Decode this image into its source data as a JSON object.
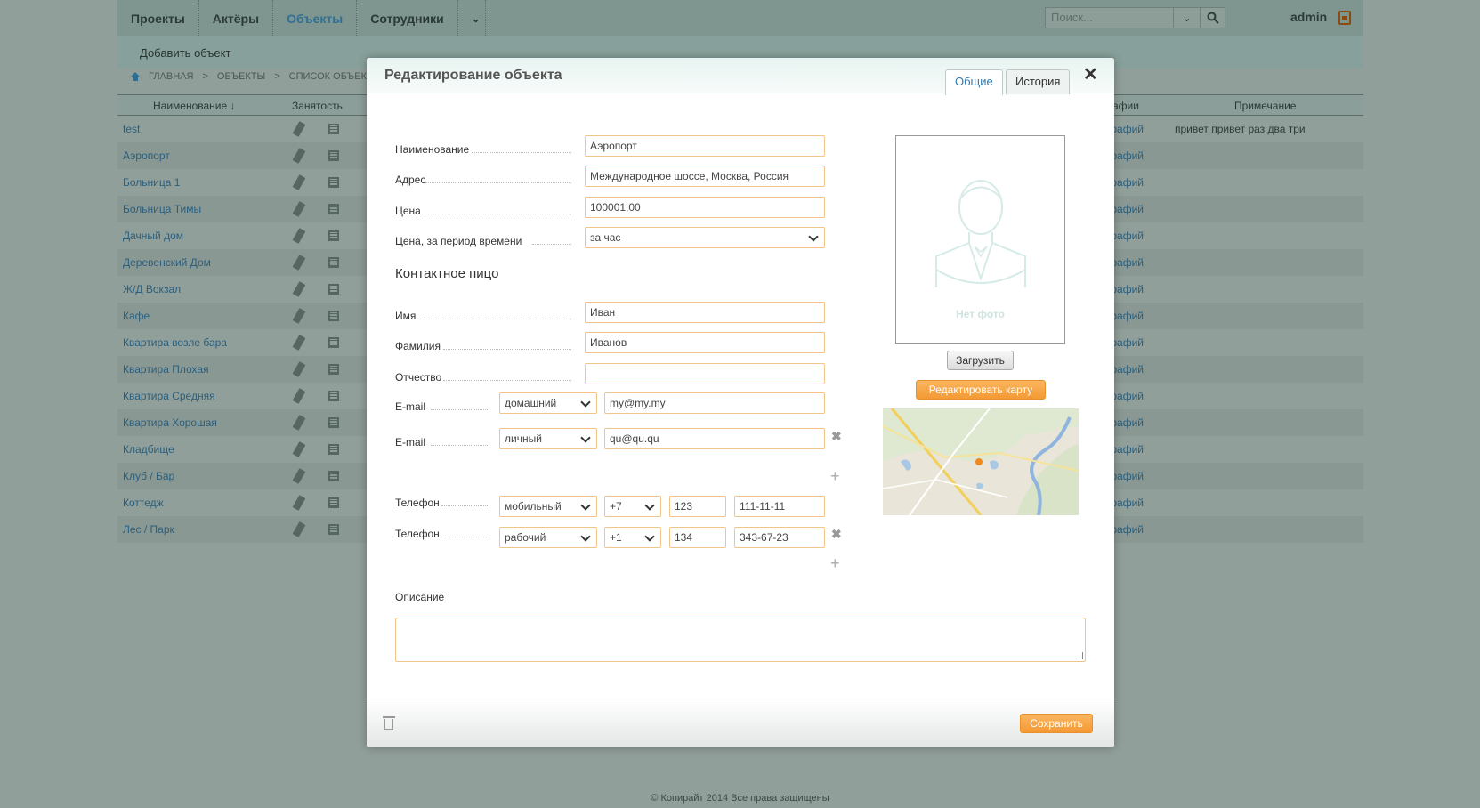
{
  "nav": {
    "items": [
      "Проекты",
      "Актёры",
      "Объекты",
      "Сотрудники"
    ],
    "active_index": 2,
    "search_placeholder": "Поиск...",
    "user": "admin"
  },
  "subbar": {
    "add_link": "Добавить объект"
  },
  "breadcrumb": {
    "home": "ГЛАВНАЯ",
    "sep": ">",
    "objects": "ОБЪЕКТЫ",
    "list": "СПИСОК ОБЪЕКТ"
  },
  "table": {
    "headers": {
      "name": "Наименование",
      "busy": "Занятость",
      "photos": "афии",
      "note": "Примечание"
    },
    "rows": [
      {
        "name": "test",
        "photos": "графий",
        "note": "привет привет раз два три"
      },
      {
        "name": "Аэропорт",
        "photos": "графий",
        "note": ""
      },
      {
        "name": "Больница 1",
        "photos": "графий",
        "note": ""
      },
      {
        "name": "Больница Тимы",
        "photos": "графий",
        "note": ""
      },
      {
        "name": "Дачный дом",
        "photos": "графий",
        "note": ""
      },
      {
        "name": "Деревенский Дом",
        "photos": "графий",
        "note": ""
      },
      {
        "name": "Ж/Д Вокзал",
        "photos": "графий",
        "note": ""
      },
      {
        "name": "Кафе",
        "photos": "графий",
        "note": ""
      },
      {
        "name": "Квартира возле бара",
        "photos": "графий",
        "note": ""
      },
      {
        "name": "Квартира Плохая",
        "photos": "графий",
        "note": ""
      },
      {
        "name": "Квартира Средняя",
        "photos": "графий",
        "note": ""
      },
      {
        "name": "Квартира Хорошая",
        "photos": "графий",
        "note": ""
      },
      {
        "name": "Кладбище",
        "photos": "графий",
        "note": ""
      },
      {
        "name": "Клуб / Бар",
        "photos": "графий",
        "note": ""
      },
      {
        "name": "Коттедж",
        "photos": "графий",
        "note": ""
      },
      {
        "name": "Лес / Парк",
        "photos": "графий",
        "note": ""
      }
    ]
  },
  "footer": "© Копирайт 2014 Все права защищены",
  "modal": {
    "title": "Редактирование объекта",
    "tabs": [
      "Общие",
      "История"
    ],
    "fields": {
      "name_label": "Наименование",
      "name_value": "Аэропорт",
      "address_label": "Адрес",
      "address_value": "Международное шоссе, Москва, Россия",
      "price_label": "Цена",
      "price_value": "100001,00",
      "period_label": "Цена, за период времени",
      "period_value": "за час"
    },
    "contact": {
      "title": "Контактное пицо",
      "first_label": "Имя",
      "first_value": "Иван",
      "last_label": "Фамилия",
      "last_value": "Иванов",
      "middle_label": "Отчество",
      "middle_value": "",
      "email1": {
        "label": "E-mail",
        "type": "домашний",
        "value": "my@my.my"
      },
      "email2": {
        "label": "E-mail",
        "type": "личный",
        "value": "qu@qu.qu"
      },
      "phone1": {
        "label": "Телефон",
        "type": "мобильный",
        "code": "+7",
        "area": "123",
        "number": "111-11-11"
      },
      "phone2": {
        "label": "Телефон",
        "type": "рабочий",
        "code": "+1",
        "area": "134",
        "number": "343-67-23"
      }
    },
    "description_label": "Описание",
    "photo": {
      "no_photo": "Нет фото",
      "upload": "Загрузить",
      "edit_map": "Редактировать карту"
    },
    "save": "Сохранить"
  },
  "colors": {
    "accent": "#f5a13e",
    "link": "#2f7cb3",
    "input_border": "#f0c48a"
  }
}
